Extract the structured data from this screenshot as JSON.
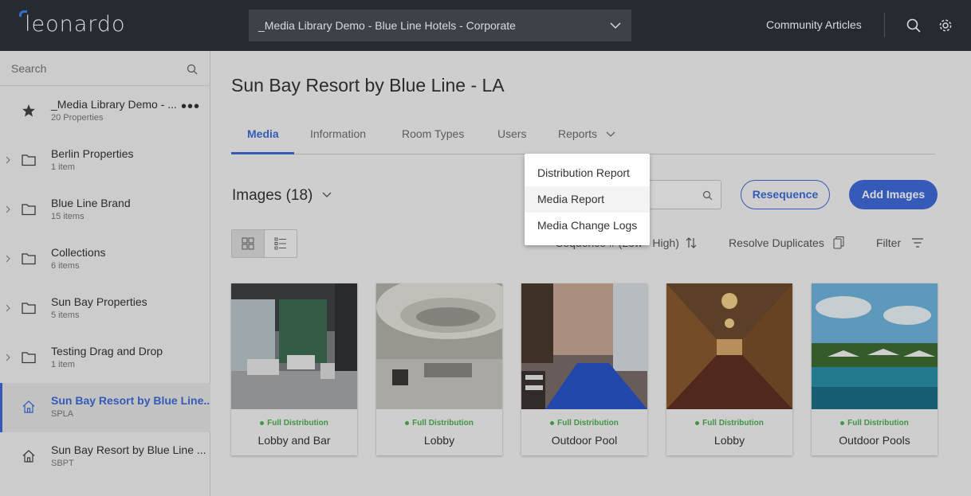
{
  "header": {
    "logo_text": "leonardo",
    "org_selector": "_Media Library Demo - Blue Line Hotels - Corporate",
    "community_link": "Community Articles",
    "icons": [
      "search-icon",
      "gear-icon"
    ]
  },
  "sidebar": {
    "search_placeholder": "Search",
    "items": [
      {
        "title": "_Media Library Demo - ...",
        "sub": "20 Properties",
        "icon": "star-icon"
      },
      {
        "title": "Berlin Properties",
        "sub": "1 item",
        "icon": "folder-icon"
      },
      {
        "title": "Blue Line Brand",
        "sub": "15 items",
        "icon": "folder-icon"
      },
      {
        "title": "Collections",
        "sub": "6 items",
        "icon": "folder-icon"
      },
      {
        "title": "Sun Bay Properties",
        "sub": "5 items",
        "icon": "folder-icon"
      },
      {
        "title": "Testing Drag and Drop",
        "sub": "1 item",
        "icon": "folder-icon"
      },
      {
        "title": "Sun Bay Resort by Blue Line..",
        "sub": "SPLA",
        "icon": "home-icon"
      },
      {
        "title": "Sun Bay Resort by Blue Line ...",
        "sub": "SBPT",
        "icon": "home-icon"
      }
    ]
  },
  "main": {
    "title": "Sun Bay Resort by Blue Line - LA",
    "tabs": [
      "Media",
      "Information",
      "Room Types",
      "Users",
      "Reports"
    ],
    "images_title": "Images (18)",
    "resequence": "Resequence",
    "add_images": "Add Images",
    "sort_label": "Sequence # (Low - High)",
    "resolve_label": "Resolve Duplicates",
    "filter_label": "Filter"
  },
  "cards": [
    {
      "status": "Full Distribution",
      "caption": "Lobby and Bar"
    },
    {
      "status": "Full Distribution",
      "caption": "Lobby"
    },
    {
      "status": "Full Distribution",
      "caption": "Outdoor Pool"
    },
    {
      "status": "Full Distribution",
      "caption": "Lobby"
    },
    {
      "status": "Full Distribution",
      "caption": "Outdoor Pools"
    }
  ],
  "reports_menu": [
    "Distribution Report",
    "Media Report",
    "Media Change Logs"
  ],
  "colors": {
    "accent": "#3f6ad8",
    "topbar": "#2d323a",
    "status_green": "#4caf50"
  }
}
